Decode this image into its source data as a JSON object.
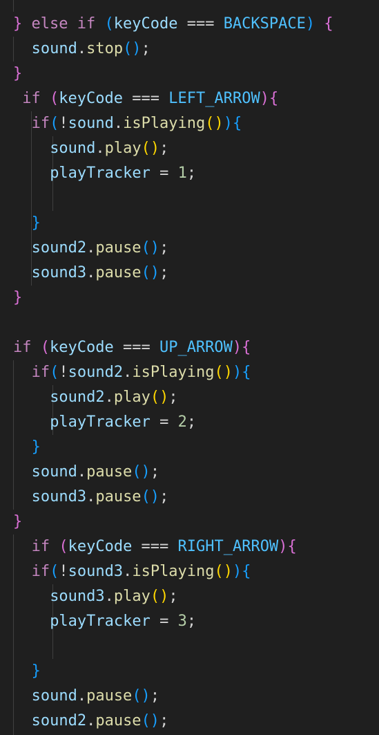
{
  "colors": {
    "background": "#1f1f1f",
    "keyword": "#c586c0",
    "identifier": "#9cdcfe",
    "function": "#dcdcaa",
    "operator": "#d4d4d4",
    "constant": "#4fc1ff",
    "number": "#b5cea8",
    "bracket1": "#da70d6",
    "bracket2": "#179fff",
    "bracket3": "#ffd700",
    "indent_guide": "#404040"
  },
  "lines": [
    {
      "indent": 0,
      "tokens": [
        [
          "}",
          "br1"
        ],
        [
          " ",
          "op"
        ],
        [
          "else",
          "kw"
        ],
        [
          " ",
          "op"
        ],
        [
          "if",
          "kw"
        ],
        [
          " ",
          "op"
        ],
        [
          "(",
          "br2"
        ],
        [
          "keyCode",
          "id"
        ],
        [
          " === ",
          "op"
        ],
        [
          "BACKSPACE",
          "const"
        ],
        [
          ")",
          "br2"
        ],
        [
          " ",
          "op"
        ],
        [
          "{",
          "br1"
        ]
      ]
    },
    {
      "indent": 2,
      "tokens": [
        [
          "sound",
          "id"
        ],
        [
          ".",
          "op"
        ],
        [
          "stop",
          "fn"
        ],
        [
          "()",
          "br2"
        ],
        [
          ";",
          "op"
        ]
      ]
    },
    {
      "indent": 0,
      "tokens": [
        [
          "}",
          "br1"
        ]
      ]
    },
    {
      "indent": 1,
      "tokens": [
        [
          "if",
          "kw"
        ],
        [
          " ",
          "op"
        ],
        [
          "(",
          "br1"
        ],
        [
          "keyCode",
          "id"
        ],
        [
          " === ",
          "op"
        ],
        [
          "LEFT_ARROW",
          "const"
        ],
        [
          ")",
          "br1"
        ],
        [
          "{",
          "br1"
        ]
      ]
    },
    {
      "indent": 2,
      "tokens": [
        [
          "if",
          "kw"
        ],
        [
          "(",
          "br2"
        ],
        [
          "!",
          "op"
        ],
        [
          "sound",
          "id"
        ],
        [
          ".",
          "op"
        ],
        [
          "isPlaying",
          "fn"
        ],
        [
          "()",
          "br3"
        ],
        [
          ")",
          "br2"
        ],
        [
          "{",
          "br2"
        ]
      ]
    },
    {
      "indent": 4,
      "tokens": [
        [
          "sound",
          "id"
        ],
        [
          ".",
          "op"
        ],
        [
          "play",
          "fn"
        ],
        [
          "()",
          "br3"
        ],
        [
          ";",
          "op"
        ]
      ]
    },
    {
      "indent": 4,
      "tokens": [
        [
          "playTracker",
          "id"
        ],
        [
          " = ",
          "op"
        ],
        [
          "1",
          "num"
        ],
        [
          ";",
          "op"
        ]
      ]
    },
    {
      "indent": 0,
      "tokens": []
    },
    {
      "indent": 2,
      "tokens": [
        [
          "}",
          "br2"
        ]
      ]
    },
    {
      "indent": 2,
      "tokens": [
        [
          "sound2",
          "id"
        ],
        [
          ".",
          "op"
        ],
        [
          "pause",
          "fn"
        ],
        [
          "()",
          "br2"
        ],
        [
          ";",
          "op"
        ]
      ]
    },
    {
      "indent": 2,
      "tokens": [
        [
          "sound3",
          "id"
        ],
        [
          ".",
          "op"
        ],
        [
          "pause",
          "fn"
        ],
        [
          "()",
          "br2"
        ],
        [
          ";",
          "op"
        ]
      ]
    },
    {
      "indent": 0,
      "tokens": [
        [
          "}",
          "br1"
        ]
      ]
    },
    {
      "indent": 0,
      "tokens": []
    },
    {
      "indent": 0,
      "tokens": [
        [
          "if",
          "kw"
        ],
        [
          " ",
          "op"
        ],
        [
          "(",
          "br1"
        ],
        [
          "keyCode",
          "id"
        ],
        [
          " === ",
          "op"
        ],
        [
          "UP_ARROW",
          "const"
        ],
        [
          ")",
          "br1"
        ],
        [
          "{",
          "br1"
        ]
      ]
    },
    {
      "indent": 2,
      "tokens": [
        [
          "if",
          "kw"
        ],
        [
          "(",
          "br2"
        ],
        [
          "!",
          "op"
        ],
        [
          "sound2",
          "id"
        ],
        [
          ".",
          "op"
        ],
        [
          "isPlaying",
          "fn"
        ],
        [
          "()",
          "br3"
        ],
        [
          ")",
          "br2"
        ],
        [
          "{",
          "br2"
        ]
      ]
    },
    {
      "indent": 4,
      "tokens": [
        [
          "sound2",
          "id"
        ],
        [
          ".",
          "op"
        ],
        [
          "play",
          "fn"
        ],
        [
          "()",
          "br3"
        ],
        [
          ";",
          "op"
        ]
      ]
    },
    {
      "indent": 4,
      "tokens": [
        [
          "playTracker",
          "id"
        ],
        [
          " = ",
          "op"
        ],
        [
          "2",
          "num"
        ],
        [
          ";",
          "op"
        ]
      ]
    },
    {
      "indent": 2,
      "tokens": [
        [
          "}",
          "br2"
        ]
      ]
    },
    {
      "indent": 2,
      "tokens": [
        [
          "sound",
          "id"
        ],
        [
          ".",
          "op"
        ],
        [
          "pause",
          "fn"
        ],
        [
          "()",
          "br2"
        ],
        [
          ";",
          "op"
        ]
      ]
    },
    {
      "indent": 2,
      "tokens": [
        [
          "sound3",
          "id"
        ],
        [
          ".",
          "op"
        ],
        [
          "pause",
          "fn"
        ],
        [
          "()",
          "br2"
        ],
        [
          ";",
          "op"
        ]
      ]
    },
    {
      "indent": 0,
      "tokens": [
        [
          "}",
          "br1"
        ]
      ]
    },
    {
      "indent": 2,
      "tokens": [
        [
          "if",
          "kw"
        ],
        [
          " ",
          "op"
        ],
        [
          "(",
          "br1"
        ],
        [
          "keyCode",
          "id"
        ],
        [
          " === ",
          "op"
        ],
        [
          "RIGHT_ARROW",
          "const"
        ],
        [
          ")",
          "br1"
        ],
        [
          "{",
          "br1"
        ]
      ]
    },
    {
      "indent": 2,
      "tokens": [
        [
          "if",
          "kw"
        ],
        [
          "(",
          "br2"
        ],
        [
          "!",
          "op"
        ],
        [
          "sound3",
          "id"
        ],
        [
          ".",
          "op"
        ],
        [
          "isPlaying",
          "fn"
        ],
        [
          "()",
          "br3"
        ],
        [
          ")",
          "br2"
        ],
        [
          "{",
          "br2"
        ]
      ]
    },
    {
      "indent": 4,
      "tokens": [
        [
          "sound3",
          "id"
        ],
        [
          ".",
          "op"
        ],
        [
          "play",
          "fn"
        ],
        [
          "()",
          "br3"
        ],
        [
          ";",
          "op"
        ]
      ]
    },
    {
      "indent": 4,
      "tokens": [
        [
          "playTracker",
          "id"
        ],
        [
          " = ",
          "op"
        ],
        [
          "3",
          "num"
        ],
        [
          ";",
          "op"
        ]
      ]
    },
    {
      "indent": 0,
      "tokens": []
    },
    {
      "indent": 2,
      "tokens": [
        [
          "}",
          "br2"
        ]
      ]
    },
    {
      "indent": 2,
      "tokens": [
        [
          "sound",
          "id"
        ],
        [
          ".",
          "op"
        ],
        [
          "pause",
          "fn"
        ],
        [
          "()",
          "br2"
        ],
        [
          ";",
          "op"
        ]
      ]
    },
    {
      "indent": 2,
      "tokens": [
        [
          "sound2",
          "id"
        ],
        [
          ".",
          "op"
        ],
        [
          "pause",
          "fn"
        ],
        [
          "()",
          "br2"
        ],
        [
          ";",
          "op"
        ]
      ]
    }
  ]
}
